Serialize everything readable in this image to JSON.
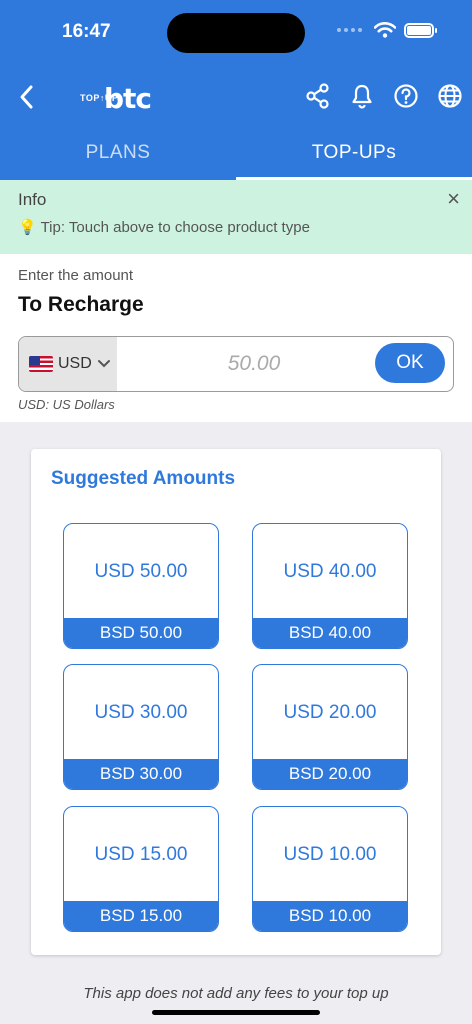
{
  "status_bar": {
    "time": "16:47"
  },
  "header": {
    "logo_small": "TOP↑UP",
    "logo_big": "btc",
    "brand_color": "#3079dc",
    "icons": [
      "back-icon",
      "share-icon",
      "bell-icon",
      "help-icon",
      "globe-icon"
    ]
  },
  "tabs": [
    {
      "label": "PLANS",
      "active": false
    },
    {
      "label": "TOP-UPs",
      "active": true
    }
  ],
  "info": {
    "title": "Info",
    "tip": "💡 Tip: Touch above to choose product type",
    "close": "×"
  },
  "entry": {
    "label": "Enter the amount",
    "heading": "To Recharge",
    "currency_code": "USD",
    "amount_placeholder": "50.00",
    "ok_label": "OK",
    "currency_note": "USD: US Dollars"
  },
  "suggested": {
    "title": "Suggested Amounts",
    "items": [
      {
        "amount": "USD 50.00",
        "local": "BSD 50.00"
      },
      {
        "amount": "USD 40.00",
        "local": "BSD 40.00"
      },
      {
        "amount": "USD 30.00",
        "local": "BSD 30.00"
      },
      {
        "amount": "USD 20.00",
        "local": "BSD 20.00"
      },
      {
        "amount": "USD 15.00",
        "local": "BSD 15.00"
      },
      {
        "amount": "USD 10.00",
        "local": "BSD 10.00"
      }
    ]
  },
  "footer": {
    "note": "This app does not add any fees to your top up"
  }
}
